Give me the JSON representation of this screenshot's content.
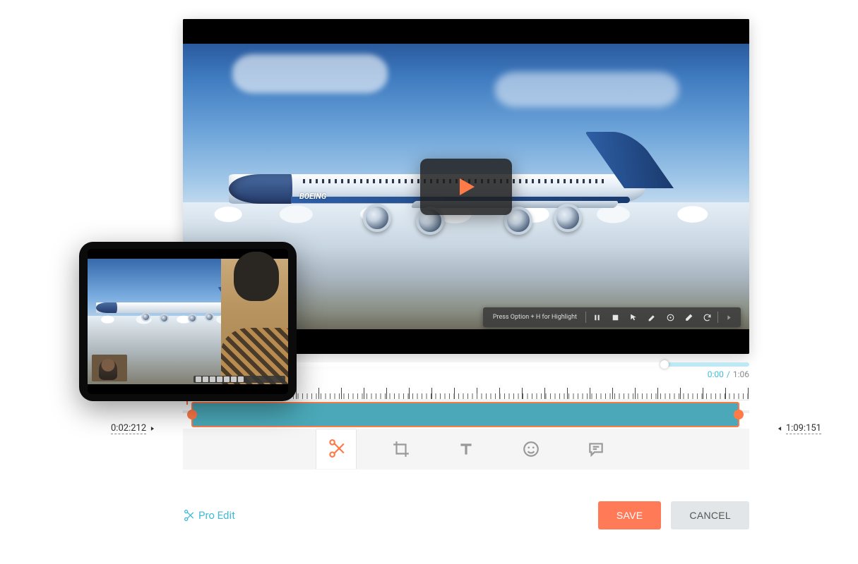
{
  "brand_on_plane": "BOEING",
  "annotation_bar": {
    "tip": "Press Option + H for Highlight"
  },
  "time": {
    "current": "0:00",
    "duration": "1:06"
  },
  "trim": {
    "start": "0:02:212",
    "end": "1:09:151"
  },
  "tools": {
    "cut": "Cut",
    "crop": "Crop",
    "text": "Text",
    "emoji": "Emoji",
    "comment": "Comment"
  },
  "footer": {
    "pro_edit": "Pro Edit",
    "save": "SAVE",
    "cancel": "CANCEL"
  }
}
